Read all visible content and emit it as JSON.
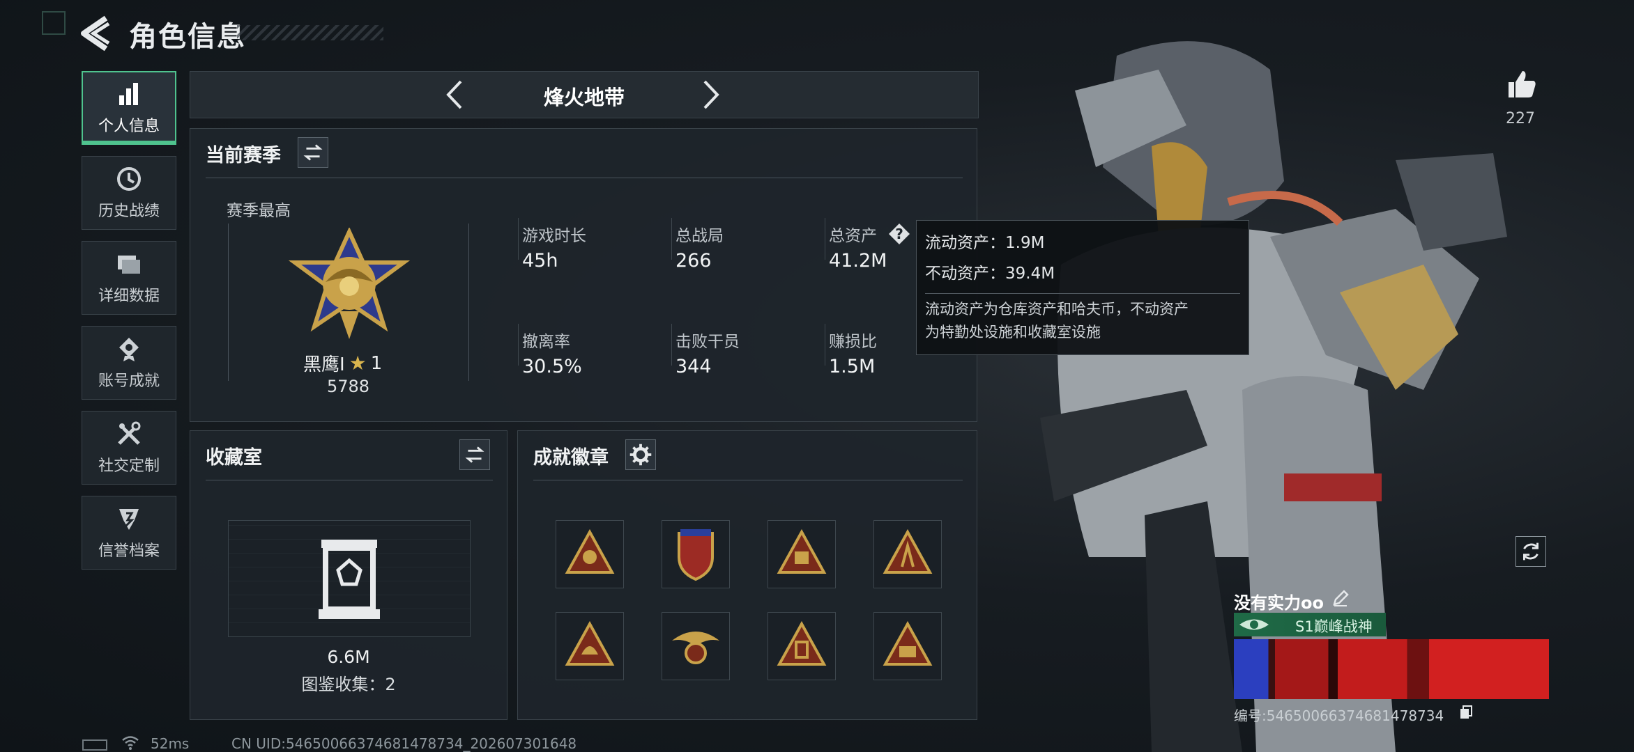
{
  "header": {
    "title": "角色信息"
  },
  "sidebar": {
    "items": [
      {
        "label": "个人信息",
        "icon": "bar-chart-icon",
        "active": true
      },
      {
        "label": "历史战绩",
        "icon": "clock-history-icon"
      },
      {
        "label": "详细数据",
        "icon": "folder-icon"
      },
      {
        "label": "账号成就",
        "icon": "medal-icon"
      },
      {
        "label": "社交定制",
        "icon": "tools-icon"
      },
      {
        "label": "信誉档案",
        "icon": "badge-shield-icon"
      }
    ]
  },
  "mode": {
    "name": "烽火地带"
  },
  "season": {
    "title": "当前赛季",
    "best_label": "赛季最高",
    "rank_name": "黑鹰I",
    "rank_stars": "1",
    "rank_score": "5788",
    "stats": [
      {
        "label": "游戏时长",
        "value": "45h"
      },
      {
        "label": "总战局",
        "value": "266"
      },
      {
        "label": "总资产",
        "value": "41.2M"
      },
      {
        "label": "撤离率",
        "value": "30.5%"
      },
      {
        "label": "击败干员",
        "value": "344"
      },
      {
        "label": "赚损比",
        "value": "1.5M"
      }
    ]
  },
  "tooltip": {
    "liquid": "流动资产：1.9M",
    "fixed": "不动资产：39.4M",
    "desc1": "流动资产为仓库资产和哈夫币，不动资产",
    "desc2": "为特勤处设施和收藏室设施"
  },
  "collection": {
    "title": "收藏室",
    "value": "6.6M",
    "count_text": "图鉴收集：2"
  },
  "achievements": {
    "title": "成就徽章"
  },
  "likes": {
    "count": "227"
  },
  "player": {
    "name": "没有实力oo",
    "title": "S1巅峰战神",
    "id_text": "编号:5465006637468147873​4"
  },
  "footer": {
    "ping": "52ms",
    "uid": "CN UID:5465006637468147873​4_202607301648"
  },
  "colors": {
    "accent": "#4fc38e",
    "gold": "#c9a24a",
    "banner_red": "#c21c1c"
  }
}
